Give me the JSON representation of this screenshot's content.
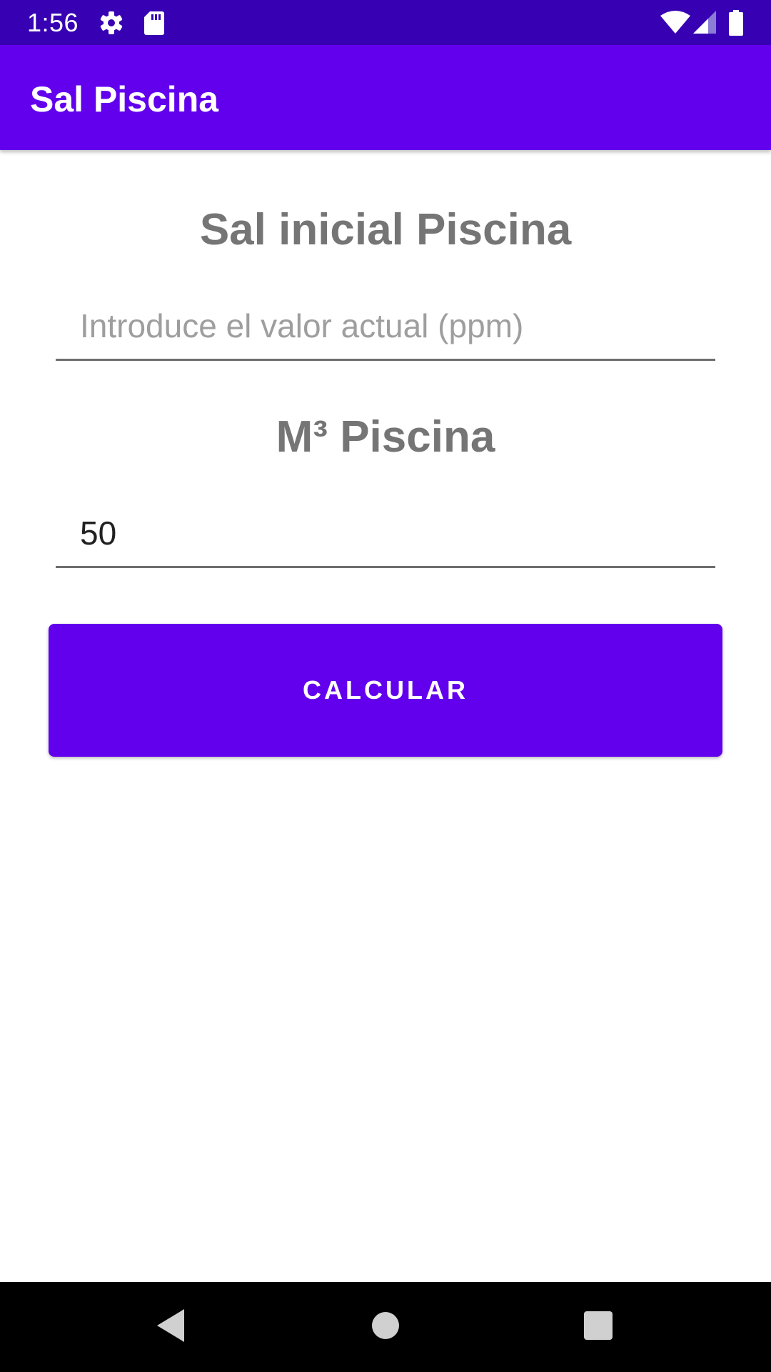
{
  "status_bar": {
    "time": "1:56",
    "icons": [
      "gear-icon",
      "sd-card-icon",
      "wifi-icon",
      "cell-signal-icon",
      "battery-icon"
    ]
  },
  "app_bar": {
    "title": "Sal Piscina"
  },
  "form": {
    "salt_heading": "Sal inicial Piscina",
    "salt_input": {
      "value": "",
      "placeholder": "Introduce el valor actual (ppm)"
    },
    "volume_heading": "M³ Piscina",
    "volume_input": {
      "value": "50",
      "placeholder": ""
    },
    "calculate_label": "CALCULAR"
  },
  "nav_bar": {
    "buttons": [
      "back-icon",
      "home-icon",
      "recents-icon"
    ]
  },
  "colors": {
    "primary": "#6200ee",
    "primary_dark": "#3700b3",
    "heading_text": "#757575",
    "placeholder_text": "#9e9e9e"
  }
}
